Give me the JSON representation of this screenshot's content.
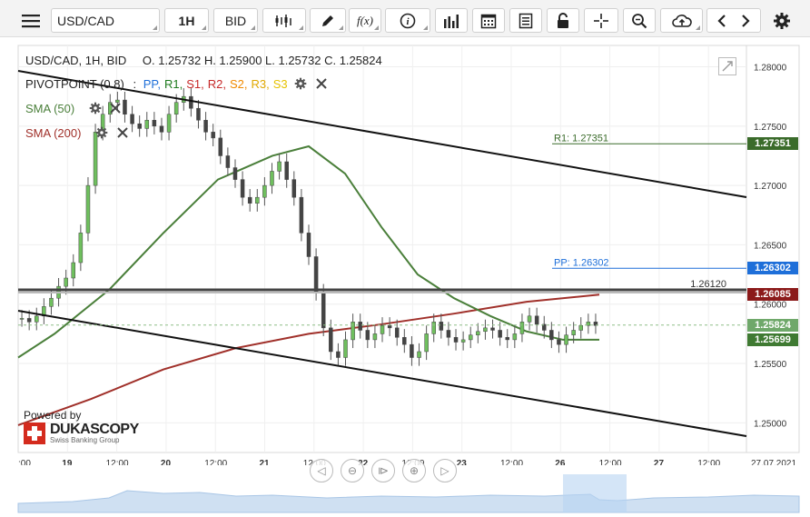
{
  "toolbar": {
    "instrument": "USD/CAD",
    "timeframe": "1H",
    "side": "BID",
    "fx_label": "f(x)"
  },
  "header": {
    "title": "USD/CAD, 1H, BID",
    "ohlc": "O. 1.25732 H. 1.25900 L. 1.25732 C. 1.25824"
  },
  "indicators": {
    "pivot": {
      "name": "PIVOTPOINT (0.8)",
      "sep": ":",
      "items": [
        {
          "label": "PP",
          "color": "#1e6fd9"
        },
        {
          "label": "R1",
          "color": "#1e7b1e"
        },
        {
          "label": "S1",
          "color": "#c62828"
        },
        {
          "label": "R2",
          "color": "#c62828"
        },
        {
          "label": "S2",
          "color": "#f08a00"
        },
        {
          "label": "R3",
          "color": "#e0a800"
        },
        {
          "label": "S3",
          "color": "#e6c200"
        }
      ]
    },
    "sma50": {
      "label": "SMA (50)",
      "color": "#4a7f3a"
    },
    "sma200": {
      "label": "SMA (200)",
      "color": "#a0302a"
    }
  },
  "levels": {
    "r1": {
      "label": "R1: 1.27351",
      "price": 1.27351,
      "tag": "1.27351",
      "color": "#3a6b2a"
    },
    "pp": {
      "label": "PP: 1.26302",
      "price": 1.26302,
      "tag": "1.26302",
      "color": "#1e6fd9"
    },
    "line_label": {
      "text": "1.26120",
      "price": 1.2612
    },
    "sma200_tag": {
      "text": "1.26085",
      "price": 1.26085,
      "color": "#8b1a1a"
    },
    "last_tag": {
      "text": "1.25824",
      "price": 1.25824,
      "color": "#6fa86a"
    },
    "sma50_tag": {
      "text": "1.25699",
      "price": 1.25699,
      "color": "#3f7a32"
    }
  },
  "y_axis": {
    "ticks": [
      "1.28000",
      "1.27500",
      "1.27000",
      "1.26500",
      "1.26000",
      "1.25500",
      "1.25000"
    ]
  },
  "x_axis": {
    "ticks": [
      ":00",
      "19",
      "12:00",
      "20",
      "12:00",
      "21",
      "12:00",
      "22",
      "12:00",
      "23",
      "12:00",
      "26",
      "12:00",
      "27",
      "12:00",
      "27.07.2021"
    ]
  },
  "branding": {
    "powered": "Powered by",
    "name": "DUKASCOPY",
    "sub": "Swiss Banking Group"
  },
  "chart_data": {
    "type": "line",
    "title": "USD/CAD, 1H, BID",
    "ylim": [
      1.2475,
      1.2818
    ],
    "note_series": [
      {
        "name": "SMA (50)",
        "x": [
          0,
          40,
          100,
          160,
          220,
          280,
          320,
          360,
          400,
          440,
          480,
          520,
          560,
          600,
          640
        ],
        "values": [
          1.2555,
          1.2575,
          1.2612,
          1.266,
          1.2705,
          1.2725,
          1.2733,
          1.271,
          1.2665,
          1.2625,
          1.2605,
          1.259,
          1.2577,
          1.257,
          1.257
        ]
      },
      {
        "name": "SMA (200)",
        "x": [
          0,
          80,
          160,
          240,
          320,
          400,
          480,
          560,
          640
        ],
        "values": [
          1.2498,
          1.252,
          1.2545,
          1.2563,
          1.2575,
          1.2583,
          1.2592,
          1.2602,
          1.2608
        ]
      }
    ]
  }
}
